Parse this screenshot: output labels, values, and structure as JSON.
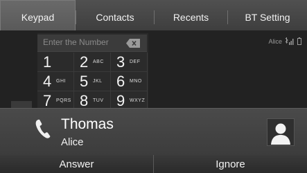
{
  "tabs": [
    {
      "label": "Keypad"
    },
    {
      "label": "Contacts"
    },
    {
      "label": "Recents"
    },
    {
      "label": "BT Setting"
    }
  ],
  "number_field": {
    "placeholder": "Enter the Number"
  },
  "keypad": [
    {
      "digit": "1",
      "letters": ""
    },
    {
      "digit": "2",
      "letters": "ABC"
    },
    {
      "digit": "3",
      "letters": "DEF"
    },
    {
      "digit": "4",
      "letters": "GHI"
    },
    {
      "digit": "5",
      "letters": "JKL"
    },
    {
      "digit": "6",
      "letters": "MNO"
    },
    {
      "digit": "7",
      "letters": "PQRS"
    },
    {
      "digit": "8",
      "letters": "TUV"
    },
    {
      "digit": "9",
      "letters": "WXYZ"
    }
  ],
  "status": {
    "device_name": "Alice"
  },
  "call": {
    "caller_name": "Thomas",
    "caller_sub": "Alice"
  },
  "actions": {
    "answer": "Answer",
    "ignore": "Ignore"
  },
  "colors": {
    "accent": "#ffffff",
    "panel": "#444444"
  }
}
